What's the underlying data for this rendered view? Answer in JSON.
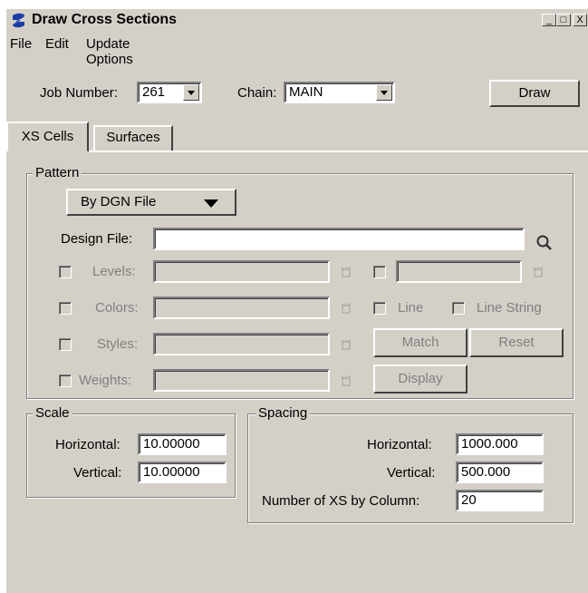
{
  "window": {
    "title": "Draw Cross Sections",
    "controls": {
      "minimize": "_",
      "maximize": "□",
      "close": "X"
    }
  },
  "menu": [
    "File",
    "Edit",
    "Update Options"
  ],
  "job": {
    "job_label": "Job Number:",
    "job_value": "261",
    "chain_label": "Chain:",
    "chain_value": "MAIN",
    "draw_button": "Draw"
  },
  "tabs": [
    "XS Cells",
    "Surfaces"
  ],
  "pattern": {
    "group_label": "Pattern",
    "mode_value": "By DGN File",
    "design_file_label": "Design File:",
    "design_file_value": "",
    "levels_label": "Levels:",
    "colors_label": "Colors:",
    "styles_label": "Styles:",
    "weights_label": "Weights:",
    "line_label": "Line",
    "line_string_label": "Line String",
    "match_button": "Match",
    "reset_button": "Reset",
    "display_button": "Display"
  },
  "scale": {
    "group_label": "Scale",
    "horizontal_label": "Horizontal:",
    "horizontal_value": "10.00000",
    "vertical_label": "Vertical:",
    "vertical_value": "10.00000"
  },
  "spacing": {
    "group_label": "Spacing",
    "horizontal_label": "Horizontal:",
    "horizontal_value": "1000.000",
    "vertical_label": "Vertical:",
    "vertical_value": "500.000",
    "columns_label": "Number of XS by Column:",
    "columns_value": "20"
  },
  "icons": {
    "app": "geopak-logo-icon",
    "browse": "magnifier-icon",
    "pick": "cell-pick-icon"
  },
  "colors": {
    "face": "#d4d0c8",
    "disabled_text": "#808080",
    "logo": "#1c3ca8"
  }
}
